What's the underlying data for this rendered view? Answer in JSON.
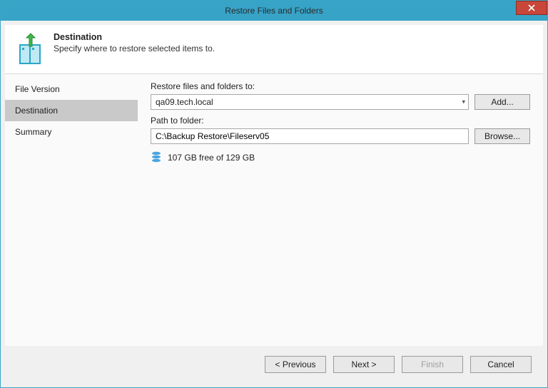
{
  "window": {
    "title": "Restore Files and Folders",
    "close_label": "Close"
  },
  "header": {
    "title": "Destination",
    "subtitle": "Specify where to restore selected items to."
  },
  "sidebar": {
    "items": [
      {
        "label": "File Version",
        "active": false
      },
      {
        "label": "Destination",
        "active": true
      },
      {
        "label": "Summary",
        "active": false
      }
    ]
  },
  "main": {
    "restore_to_label": "Restore files and folders to:",
    "host_value": "qa09.tech.local",
    "add_label": "Add...",
    "path_label": "Path to folder:",
    "path_value": "C:\\Backup Restore\\Fileserv05",
    "browse_label": "Browse...",
    "disk_free": "107 GB free of 129 GB"
  },
  "footer": {
    "previous": "< Previous",
    "next": "Next >",
    "finish": "Finish",
    "cancel": "Cancel"
  }
}
